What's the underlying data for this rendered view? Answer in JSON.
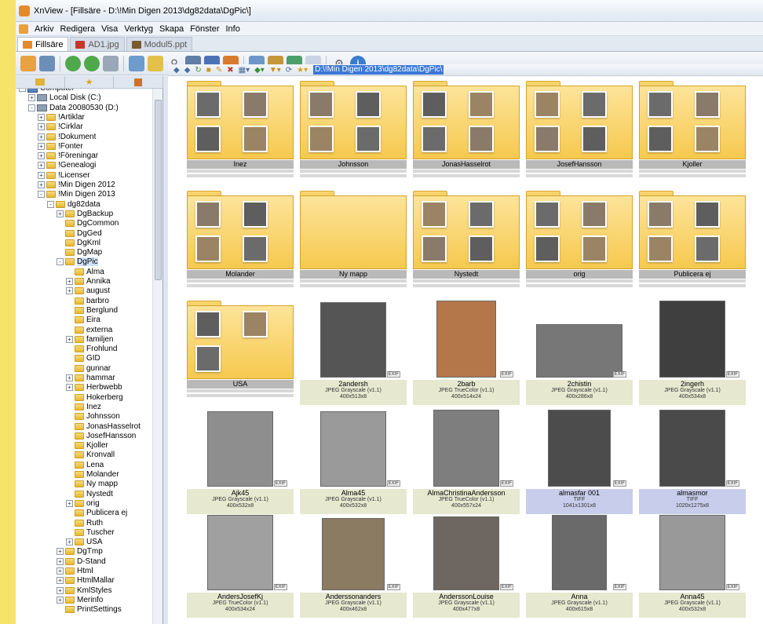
{
  "window": {
    "title": "XnView - [Fillsäre - D:\\!Min Digen 2013\\dg82data\\DgPic\\]"
  },
  "menu": [
    "Arkiv",
    "Redigera",
    "Visa",
    "Verktyg",
    "Skapa",
    "Fönster",
    "Info"
  ],
  "tabs": [
    {
      "label": "Fillsäre",
      "active": true
    },
    {
      "label": "AD1.jpg",
      "active": false
    },
    {
      "label": "Modul5.ppt",
      "active": false
    }
  ],
  "path": "D:\\!Min Digen 2013\\dg82data\\DgPic\\",
  "tree": [
    {
      "label": "Computer",
      "level": 0,
      "exp": "-",
      "icon": "comp"
    },
    {
      "label": "Local Disk (C:)",
      "level": 1,
      "exp": "+",
      "icon": "drive"
    },
    {
      "label": "Data 20080530 (D:)",
      "level": 1,
      "exp": "-",
      "icon": "drive"
    },
    {
      "label": "!Artiklar",
      "level": 2,
      "exp": "+"
    },
    {
      "label": "!Cirklar",
      "level": 2,
      "exp": "+"
    },
    {
      "label": "!Dokument",
      "level": 2,
      "exp": "+"
    },
    {
      "label": "!Fonter",
      "level": 2,
      "exp": "+"
    },
    {
      "label": "!Föreningar",
      "level": 2,
      "exp": "+"
    },
    {
      "label": "!Genealogi",
      "level": 2,
      "exp": "+"
    },
    {
      "label": "!Licenser",
      "level": 2,
      "exp": "+"
    },
    {
      "label": "!Min Digen 2012",
      "level": 2,
      "exp": "+"
    },
    {
      "label": "!Min Digen 2013",
      "level": 2,
      "exp": "-"
    },
    {
      "label": "dg82data",
      "level": 3,
      "exp": "-"
    },
    {
      "label": "DgBackup",
      "level": 4,
      "exp": "+"
    },
    {
      "label": "DgCommon",
      "level": 4,
      "exp": ""
    },
    {
      "label": "DgGed",
      "level": 4,
      "exp": ""
    },
    {
      "label": "DgKml",
      "level": 4,
      "exp": ""
    },
    {
      "label": "DgMap",
      "level": 4,
      "exp": ""
    },
    {
      "label": "DgPic",
      "level": 4,
      "exp": "-"
    },
    {
      "label": "Alma",
      "level": 5,
      "exp": ""
    },
    {
      "label": "Annika",
      "level": 5,
      "exp": "+"
    },
    {
      "label": "august",
      "level": 5,
      "exp": "+"
    },
    {
      "label": "barbro",
      "level": 5,
      "exp": ""
    },
    {
      "label": "Berglund",
      "level": 5,
      "exp": ""
    },
    {
      "label": "Eira",
      "level": 5,
      "exp": ""
    },
    {
      "label": "externa",
      "level": 5,
      "exp": ""
    },
    {
      "label": "familjen",
      "level": 5,
      "exp": "+"
    },
    {
      "label": "Frohlund",
      "level": 5,
      "exp": ""
    },
    {
      "label": "GID",
      "level": 5,
      "exp": ""
    },
    {
      "label": "gunnar",
      "level": 5,
      "exp": ""
    },
    {
      "label": "hammar",
      "level": 5,
      "exp": "+"
    },
    {
      "label": "Herbwebb",
      "level": 5,
      "exp": "+"
    },
    {
      "label": "Hokerberg",
      "level": 5,
      "exp": ""
    },
    {
      "label": "Inez",
      "level": 5,
      "exp": ""
    },
    {
      "label": "Johnsson",
      "level": 5,
      "exp": ""
    },
    {
      "label": "JonasHasselrot",
      "level": 5,
      "exp": ""
    },
    {
      "label": "JosefHansson",
      "level": 5,
      "exp": ""
    },
    {
      "label": "Kjoller",
      "level": 5,
      "exp": ""
    },
    {
      "label": "Kronvall",
      "level": 5,
      "exp": ""
    },
    {
      "label": "Lena",
      "level": 5,
      "exp": ""
    },
    {
      "label": "Molander",
      "level": 5,
      "exp": ""
    },
    {
      "label": "Ny mapp",
      "level": 5,
      "exp": ""
    },
    {
      "label": "Nystedt",
      "level": 5,
      "exp": ""
    },
    {
      "label": "orig",
      "level": 5,
      "exp": "+"
    },
    {
      "label": "Publicera ej",
      "level": 5,
      "exp": ""
    },
    {
      "label": "Ruth",
      "level": 5,
      "exp": ""
    },
    {
      "label": "Tuscher",
      "level": 5,
      "exp": ""
    },
    {
      "label": "USA",
      "level": 5,
      "exp": "+"
    },
    {
      "label": "DgTmp",
      "level": 4,
      "exp": "+"
    },
    {
      "label": "D-Stand",
      "level": 4,
      "exp": "+"
    },
    {
      "label": "Html",
      "level": 4,
      "exp": "+"
    },
    {
      "label": "HtmlMallar",
      "level": 4,
      "exp": "+"
    },
    {
      "label": "KmlStyles",
      "level": 4,
      "exp": "+"
    },
    {
      "label": "Merinfo",
      "level": 4,
      "exp": "+"
    },
    {
      "label": "PrintSettings",
      "level": 4,
      "exp": ""
    }
  ],
  "folders": [
    {
      "name": "Inez",
      "thumbs": 4
    },
    {
      "name": "Johnsson",
      "thumbs": 4
    },
    {
      "name": "JonasHasselrot",
      "thumbs": 4
    },
    {
      "name": "JosefHansson",
      "thumbs": 4
    },
    {
      "name": "Kjoller",
      "thumbs": 4
    },
    {
      "name": "Molander",
      "thumbs": 4
    },
    {
      "name": "Ny mapp",
      "thumbs": 0
    },
    {
      "name": "Nystedt",
      "thumbs": 4
    },
    {
      "name": "orig",
      "thumbs": 4
    },
    {
      "name": "Publicera ej",
      "thumbs": 4
    },
    {
      "name": "USA",
      "thumbs": 3
    }
  ],
  "images": [
    {
      "name": "2andersh",
      "format": "JPEG Grayscale (v1.1)",
      "dims": "400x513x8",
      "badge": "EXIF",
      "sel": false
    },
    {
      "name": "2barb",
      "format": "JPEG TrueColor (v1.1)",
      "dims": "400x514x24",
      "badge": "EXIF",
      "sel": false
    },
    {
      "name": "2chistin",
      "format": "JPEG Grayscale (v1.1)",
      "dims": "400x286x8",
      "badge": "EXIF",
      "sel": false
    },
    {
      "name": "2ingerh",
      "format": "JPEG Grayscale (v1.1)",
      "dims": "400x534x8",
      "badge": "EXIF",
      "sel": false
    },
    {
      "name": "Ajk45",
      "format": "JPEG Grayscale (v1.1)",
      "dims": "400x532x8",
      "badge": "EXIF",
      "sel": false
    },
    {
      "name": "Alma45",
      "format": "JPEG Grayscale (v1.1)",
      "dims": "400x532x8",
      "badge": "EXIF",
      "sel": false
    },
    {
      "name": "AlmaChristinaAndersson",
      "format": "JPEG TrueColor (v1.1)",
      "dims": "400x557x24",
      "badge": "EXIF",
      "sel": false
    },
    {
      "name": "almasfar 001",
      "format": "TIFF",
      "dims": "1041x1301x8",
      "badge": "EXIF",
      "sel": true
    },
    {
      "name": "almasmor",
      "format": "TIFF",
      "dims": "1020x1275x8",
      "badge": "EXIF",
      "sel": true
    },
    {
      "name": "AndersJosefKj",
      "format": "JPEG TrueColor (v1.1)",
      "dims": "400x534x24",
      "badge": "EXIF",
      "sel": false
    },
    {
      "name": "Anderssonanders",
      "format": "JPEG Grayscale (v1.1)",
      "dims": "400x462x8",
      "badge": "EXIF",
      "sel": false
    },
    {
      "name": "AnderssonLouise",
      "format": "JPEG Grayscale (v1.1)",
      "dims": "400x477x8",
      "badge": "EXIF",
      "sel": false
    },
    {
      "name": "Anna",
      "format": "JPEG Grayscale (v1.1)",
      "dims": "400x615x8",
      "badge": "EXIF",
      "sel": false
    },
    {
      "name": "Anna45",
      "format": "JPEG Grayscale (v1.1)",
      "dims": "400x532x8",
      "badge": "EXIF",
      "sel": false
    }
  ]
}
